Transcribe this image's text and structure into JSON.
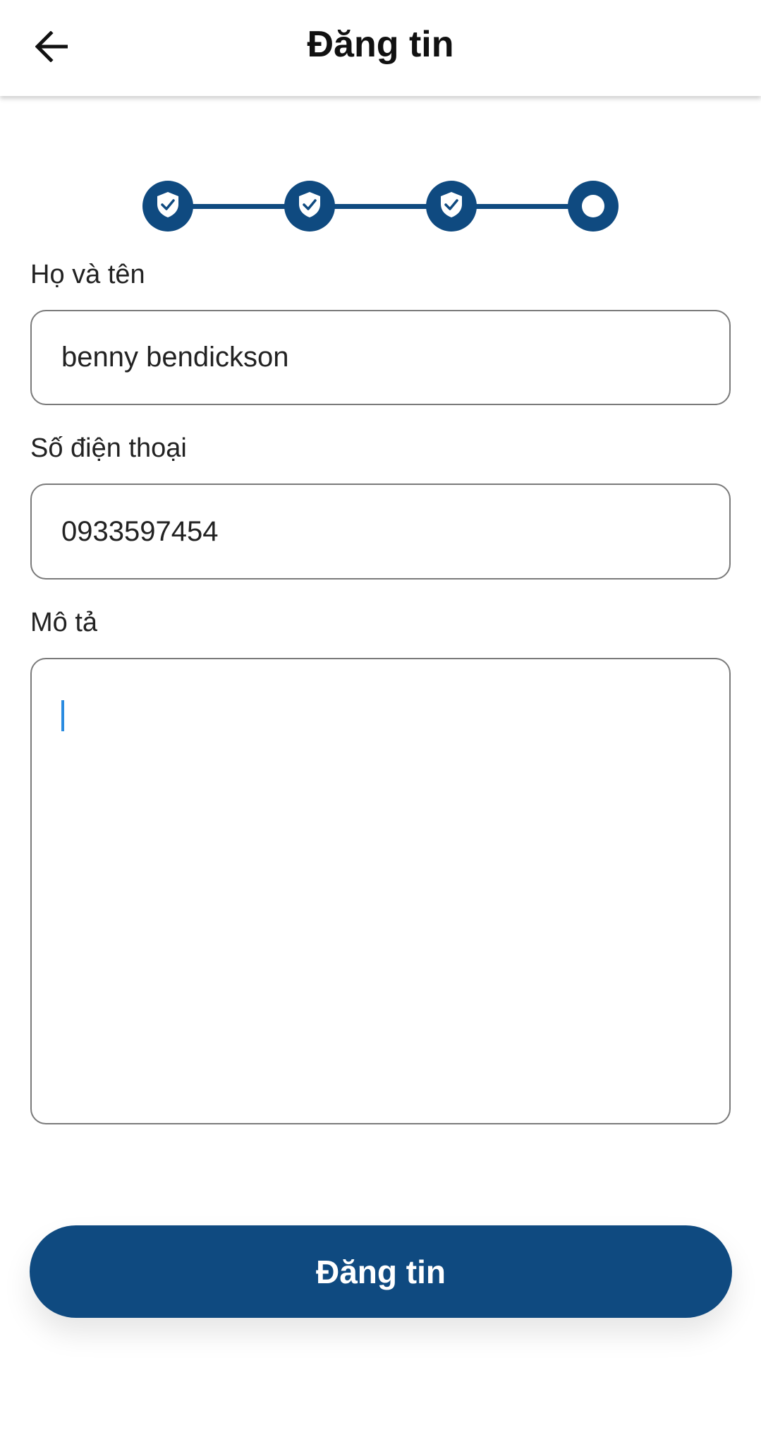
{
  "appbar": {
    "title": "Đăng tin",
    "back_icon": "arrow-left-icon"
  },
  "stepper": {
    "steps": [
      {
        "state": "completed",
        "icon": "shield-check-icon"
      },
      {
        "state": "completed",
        "icon": "shield-check-icon"
      },
      {
        "state": "completed",
        "icon": "shield-check-icon"
      },
      {
        "state": "current",
        "icon": "circle-icon"
      }
    ],
    "color": "#0f4a80"
  },
  "form": {
    "name": {
      "label": "Họ và tên",
      "value": "benny bendickson"
    },
    "phone": {
      "label": "Số điện thoại",
      "value": "0933597454"
    },
    "description": {
      "label": "Mô tả",
      "value": ""
    }
  },
  "submit": {
    "label": "Đăng tin"
  },
  "colors": {
    "primary": "#0f4a80",
    "caret": "#2a8be0",
    "border": "#7a7a7a"
  }
}
